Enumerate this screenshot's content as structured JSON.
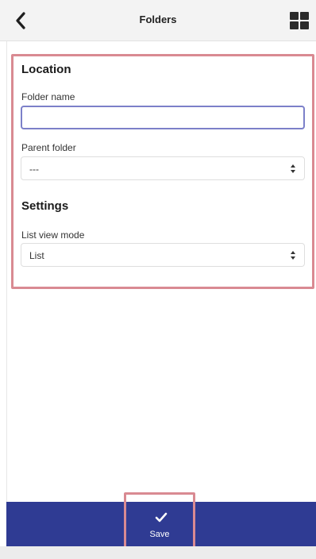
{
  "header": {
    "title": "Folders",
    "back_icon": "chevron-left-icon",
    "view_icon": "grid-view-icon"
  },
  "form": {
    "location_title": "Location",
    "folder_name_label": "Folder name",
    "folder_name_value": "",
    "parent_folder_label": "Parent folder",
    "parent_folder_value": "---",
    "settings_title": "Settings",
    "list_view_label": "List view mode",
    "list_view_value": "List"
  },
  "footer": {
    "save_label": "Save",
    "save_icon": "checkmark-icon"
  },
  "colors": {
    "bar": "#2f3b93",
    "highlight": "#d98a92",
    "input_focus": "#7c80c9"
  }
}
